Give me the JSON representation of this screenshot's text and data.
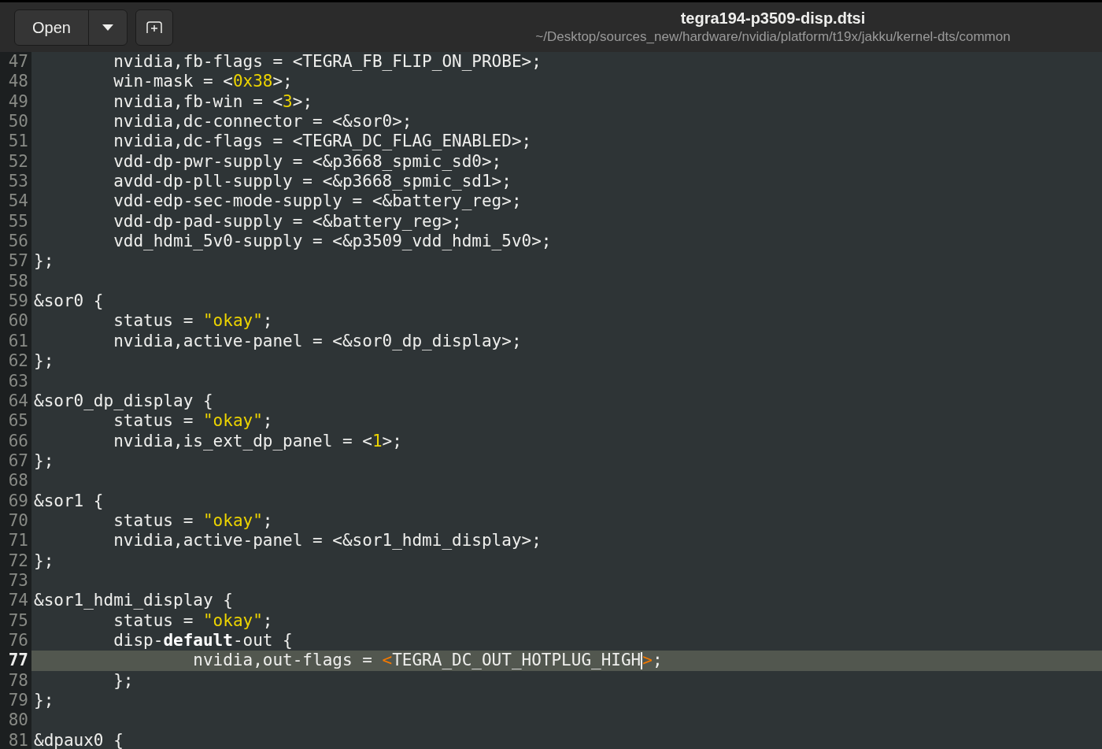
{
  "header": {
    "open_button": "Open",
    "title": "tegra194-p3509-disp.dtsi",
    "subtitle": "~/Desktop/sources_new/hardware/nvidia/platform/t19x/jakku/kernel-dts/common"
  },
  "lines": [
    {
      "number": "47",
      "current": false,
      "segments": [
        {
          "kind": "plain",
          "text": "\tnvidia,fb-flags = <TEGRA_FB_FLIP_ON_PROBE>;"
        }
      ]
    },
    {
      "number": "48",
      "current": false,
      "segments": [
        {
          "kind": "plain",
          "text": "\twin-mask = <"
        },
        {
          "kind": "number",
          "text": "0x38"
        },
        {
          "kind": "plain",
          "text": ">;"
        }
      ]
    },
    {
      "number": "49",
      "current": false,
      "segments": [
        {
          "kind": "plain",
          "text": "\tnvidia,fb-win = <"
        },
        {
          "kind": "number",
          "text": "3"
        },
        {
          "kind": "plain",
          "text": ">;"
        }
      ]
    },
    {
      "number": "50",
      "current": false,
      "segments": [
        {
          "kind": "plain",
          "text": "\tnvidia,dc-connector = <&sor0>;"
        }
      ]
    },
    {
      "number": "51",
      "current": false,
      "segments": [
        {
          "kind": "plain",
          "text": "\tnvidia,dc-flags = <TEGRA_DC_FLAG_ENABLED>;"
        }
      ]
    },
    {
      "number": "52",
      "current": false,
      "segments": [
        {
          "kind": "plain",
          "text": "\tvdd-dp-pwr-supply = <&p3668_spmic_sd0>;"
        }
      ]
    },
    {
      "number": "53",
      "current": false,
      "segments": [
        {
          "kind": "plain",
          "text": "\tavdd-dp-pll-supply = <&p3668_spmic_sd1>;"
        }
      ]
    },
    {
      "number": "54",
      "current": false,
      "segments": [
        {
          "kind": "plain",
          "text": "\tvdd-edp-sec-mode-supply = <&battery_reg>;"
        }
      ]
    },
    {
      "number": "55",
      "current": false,
      "segments": [
        {
          "kind": "plain",
          "text": "\tvdd-dp-pad-supply = <&battery_reg>;"
        }
      ]
    },
    {
      "number": "56",
      "current": false,
      "segments": [
        {
          "kind": "plain",
          "text": "\tvdd_hdmi_5v0-supply = <&p3509_vdd_hdmi_5v0>;"
        }
      ]
    },
    {
      "number": "57",
      "current": false,
      "segments": [
        {
          "kind": "plain",
          "text": "};"
        }
      ]
    },
    {
      "number": "58",
      "current": false
    },
    {
      "number": "59",
      "current": false,
      "segments": [
        {
          "kind": "plain",
          "text": "&sor0 {"
        }
      ]
    },
    {
      "number": "60",
      "current": false,
      "segments": [
        {
          "kind": "plain",
          "text": "\tstatus = "
        },
        {
          "kind": "string",
          "text": "\"okay\""
        },
        {
          "kind": "plain",
          "text": ";"
        }
      ]
    },
    {
      "number": "61",
      "current": false,
      "segments": [
        {
          "kind": "plain",
          "text": "\tnvidia,active-panel = <&sor0_dp_display>;"
        }
      ]
    },
    {
      "number": "62",
      "current": false,
      "segments": [
        {
          "kind": "plain",
          "text": "};"
        }
      ]
    },
    {
      "number": "63",
      "current": false
    },
    {
      "number": "64",
      "current": false,
      "segments": [
        {
          "kind": "plain",
          "text": "&sor0_dp_display {"
        }
      ]
    },
    {
      "number": "65",
      "current": false,
      "segments": [
        {
          "kind": "plain",
          "text": "\tstatus = "
        },
        {
          "kind": "string",
          "text": "\"okay\""
        },
        {
          "kind": "plain",
          "text": ";"
        }
      ]
    },
    {
      "number": "66",
      "current": false,
      "segments": [
        {
          "kind": "plain",
          "text": "\tnvidia,is_ext_dp_panel = <"
        },
        {
          "kind": "number",
          "text": "1"
        },
        {
          "kind": "plain",
          "text": ">;"
        }
      ]
    },
    {
      "number": "67",
      "current": false,
      "segments": [
        {
          "kind": "plain",
          "text": "};"
        }
      ]
    },
    {
      "number": "68",
      "current": false
    },
    {
      "number": "69",
      "current": false,
      "segments": [
        {
          "kind": "plain",
          "text": "&sor1 {"
        }
      ]
    },
    {
      "number": "70",
      "current": false,
      "segments": [
        {
          "kind": "plain",
          "text": "\tstatus = "
        },
        {
          "kind": "string",
          "text": "\"okay\""
        },
        {
          "kind": "plain",
          "text": ";"
        }
      ]
    },
    {
      "number": "71",
      "current": false,
      "segments": [
        {
          "kind": "plain",
          "text": "\tnvidia,active-panel = <&sor1_hdmi_display>;"
        }
      ]
    },
    {
      "number": "72",
      "current": false,
      "segments": [
        {
          "kind": "plain",
          "text": "};"
        }
      ]
    },
    {
      "number": "73",
      "current": false
    },
    {
      "number": "74",
      "current": false,
      "segments": [
        {
          "kind": "plain",
          "text": "&sor1_hdmi_display {"
        }
      ]
    },
    {
      "number": "75",
      "current": false,
      "segments": [
        {
          "kind": "plain",
          "text": "\tstatus = "
        },
        {
          "kind": "string",
          "text": "\"okay\""
        },
        {
          "kind": "plain",
          "text": ";"
        }
      ]
    },
    {
      "number": "76",
      "current": false,
      "segments": [
        {
          "kind": "plain",
          "text": "\tdisp-"
        },
        {
          "kind": "keyword",
          "text": "default"
        },
        {
          "kind": "plain",
          "text": "-out {"
        }
      ]
    },
    {
      "number": "77",
      "current": true,
      "segments": [
        {
          "kind": "plain",
          "text": "\t\tnvidia,out-flags = "
        },
        {
          "kind": "bracket",
          "text": "<"
        },
        {
          "kind": "plain",
          "text": "TEGRA_DC_OUT_HOTPLUG_HIGH"
        },
        {
          "kind": "cursor"
        },
        {
          "kind": "bracket",
          "text": ">"
        },
        {
          "kind": "plain",
          "text": ";"
        }
      ]
    },
    {
      "number": "78",
      "current": false,
      "segments": [
        {
          "kind": "plain",
          "text": "\t};"
        }
      ]
    },
    {
      "number": "79",
      "current": false,
      "segments": [
        {
          "kind": "plain",
          "text": "};"
        }
      ]
    },
    {
      "number": "80",
      "current": false
    },
    {
      "number": "81",
      "current": false,
      "segments": [
        {
          "kind": "plain",
          "text": "&dpaux0 {"
        }
      ]
    }
  ]
}
